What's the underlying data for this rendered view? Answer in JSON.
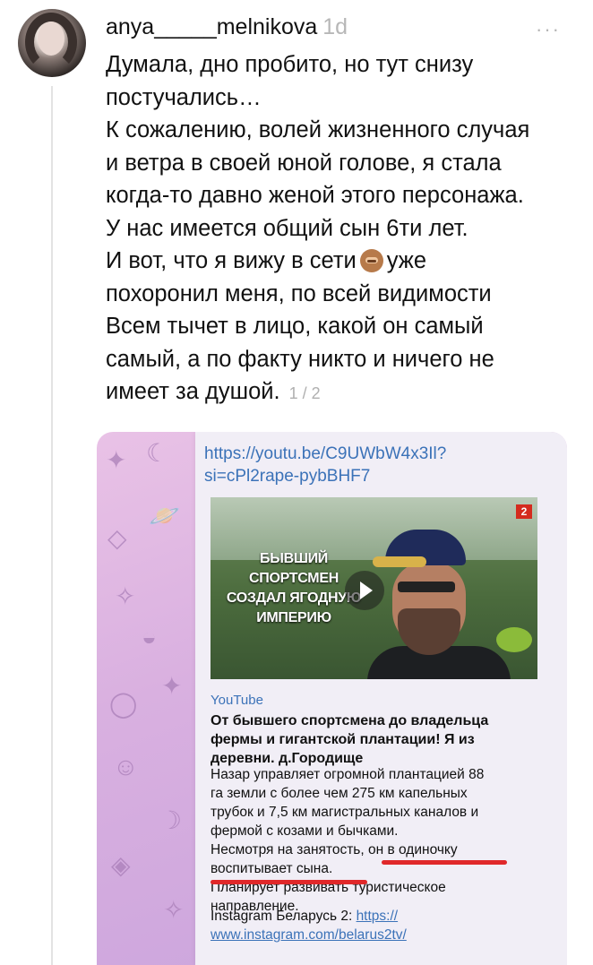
{
  "post": {
    "username": "anya_____melnikova",
    "time_ago": "1d",
    "more_label": "···",
    "lines": [
      "Думала, дно пробито, но тут снизу",
      "постучались…",
      "К сожалению, волей жизненного случая",
      "и ветра в своей юной голове, я стала",
      "когда-то давно женой этого персонажа.",
      "У нас имеется общий сын 6ти лет.",
      "И вот, что я вижу в сети",
      "уже",
      "похоронил меня, по всей видимости",
      "Всем тычет в лицо, какой он самый",
      "самый, а по факту никто и ничего не",
      "имеет за душой."
    ],
    "image_counter": "1 / 2"
  },
  "attachment": {
    "link_top_1": "https://youtu.be/C9UWbW4x3Il?",
    "link_top_2": "si=cPl2rape-pybBHF7",
    "video_overlay": "БЫВШИЙ СПОРТСМЕН СОЗДАЛ ЯГОДНУЮ ИМПЕРИЮ",
    "channel_badge": "2",
    "source_label": "YouTube",
    "title": "От бывшего спортсмена до владельца фермы и гигантской плантации! Я из деревни. д.Городище",
    "desc_lines": [
      "Назар управляет огромной плантацией 88",
      "га земли с более чем 275 км капельных",
      "трубок и 7,5 км магистральных каналов и",
      "фермой с козами и бычками.",
      "Несмотря на занятость, он в одиночку",
      "воспитывает сына.",
      "Планирует развивать туристическое",
      "направление."
    ],
    "insta_prefix": "Instagram Беларусь 2: ",
    "insta_link_1": "https://",
    "insta_link_2": "www.instagram.com/belarus2tv/"
  },
  "colors": {
    "link": "#3b72b8",
    "underline_annotation": "#e0282a",
    "telegram_bg": "#d9b0e0"
  },
  "icons": [
    "avatar",
    "monkey-emoji-icon",
    "more-icon",
    "play-icon"
  ]
}
